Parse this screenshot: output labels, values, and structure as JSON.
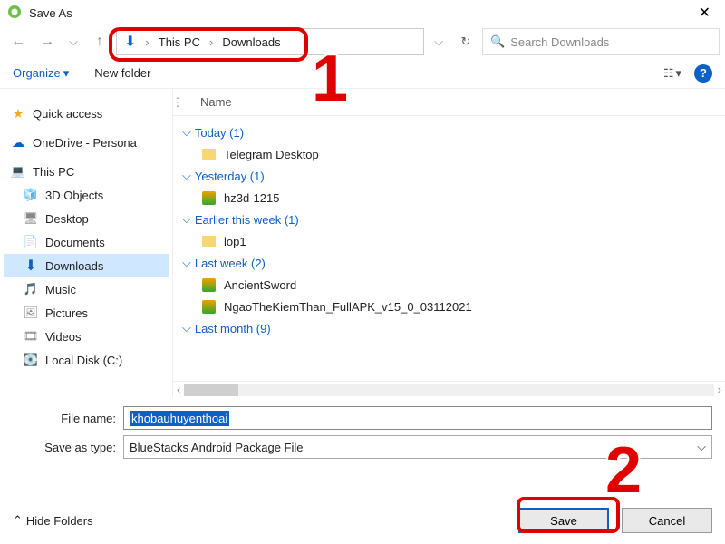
{
  "window": {
    "title": "Save As",
    "close_glyph": "✕"
  },
  "nav": {
    "back_glyph": "←",
    "fwd_glyph": "→",
    "up_glyph": "↑",
    "breadcrumb": {
      "root_icon": "⬇",
      "root": "This PC",
      "folder": "Downloads",
      "sep": "›"
    },
    "dropdown_glyph": "⌵",
    "refresh_glyph": "↻",
    "search_placeholder": "Search Downloads",
    "search_icon": "🔍"
  },
  "toolbar": {
    "organize": "Organize",
    "organize_caret": "▾",
    "new_folder": "New folder",
    "view_glyph": "☷",
    "view_caret": "▾",
    "help_glyph": "?"
  },
  "sidebar": {
    "items": [
      {
        "icon": "★",
        "cls": "star",
        "label": "Quick access"
      },
      {
        "icon": "☁",
        "cls": "cloud",
        "label": "OneDrive - Persona"
      },
      {
        "icon": "💻",
        "cls": "pc",
        "label": "This PC"
      },
      {
        "icon": "🧊",
        "cls": "grey",
        "label": "3D Objects",
        "sub": true
      },
      {
        "icon": "🖥",
        "cls": "grey",
        "label": "Desktop",
        "sub": true
      },
      {
        "icon": "📄",
        "cls": "grey",
        "label": "Documents",
        "sub": true
      },
      {
        "icon": "⬇",
        "cls": "dl-arrow",
        "label": "Downloads",
        "sub": true,
        "selected": true
      },
      {
        "icon": "🎵",
        "cls": "grey",
        "label": "Music",
        "sub": true
      },
      {
        "icon": "🖼",
        "cls": "grey",
        "label": "Pictures",
        "sub": true
      },
      {
        "icon": "🎞",
        "cls": "grey",
        "label": "Videos",
        "sub": true
      },
      {
        "icon": "💽",
        "cls": "grey",
        "label": "Local Disk (C:)",
        "sub": true
      }
    ]
  },
  "filepane": {
    "column_header": "Name",
    "resizer_glyph": "⋮",
    "groups": [
      {
        "label": "Today (1)",
        "items": [
          {
            "type": "folder",
            "name": "Telegram Desktop"
          }
        ]
      },
      {
        "label": "Yesterday (1)",
        "items": [
          {
            "type": "apk",
            "name": "hz3d-1215"
          }
        ]
      },
      {
        "label": "Earlier this week (1)",
        "items": [
          {
            "type": "folder",
            "name": "lop1"
          }
        ]
      },
      {
        "label": "Last week (2)",
        "items": [
          {
            "type": "apk",
            "name": "AncientSword"
          },
          {
            "type": "apk",
            "name": "NgaoTheKiemThan_FullAPK_v15_0_03112021"
          }
        ]
      },
      {
        "label": "Last month (9)",
        "items": []
      }
    ],
    "group_caret": "⌵",
    "scroll_left": "‹",
    "scroll_right": "›"
  },
  "form": {
    "filename_label": "File name:",
    "filename_value": "khobauhuyenthoai",
    "type_label": "Save as type:",
    "type_value": "BlueStacks Android Package File",
    "type_caret": "⌵"
  },
  "bottom": {
    "hide_folders_caret": "⌃",
    "hide_folders": "Hide Folders",
    "save": "Save",
    "cancel": "Cancel"
  },
  "annotations": {
    "n1": "1",
    "n2": "2"
  }
}
